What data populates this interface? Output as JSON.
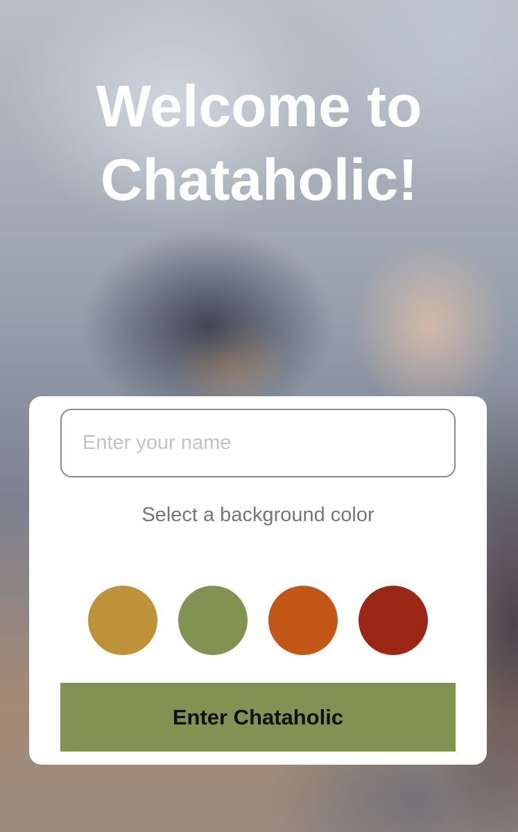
{
  "header": {
    "title_line_1": "Welcome to",
    "title_line_2": "Chataholic!"
  },
  "form": {
    "name_placeholder": "Enter your name",
    "name_value": "",
    "color_label": "Select a background color",
    "color_options": [
      {
        "name": "mustard",
        "hex": "#BD9238"
      },
      {
        "name": "olive-green",
        "hex": "#819253"
      },
      {
        "name": "burnt-orange",
        "hex": "#C25718"
      },
      {
        "name": "dark-red",
        "hex": "#9B2817"
      }
    ],
    "button_label": "Enter Chataholic",
    "button_color": "#819253"
  }
}
